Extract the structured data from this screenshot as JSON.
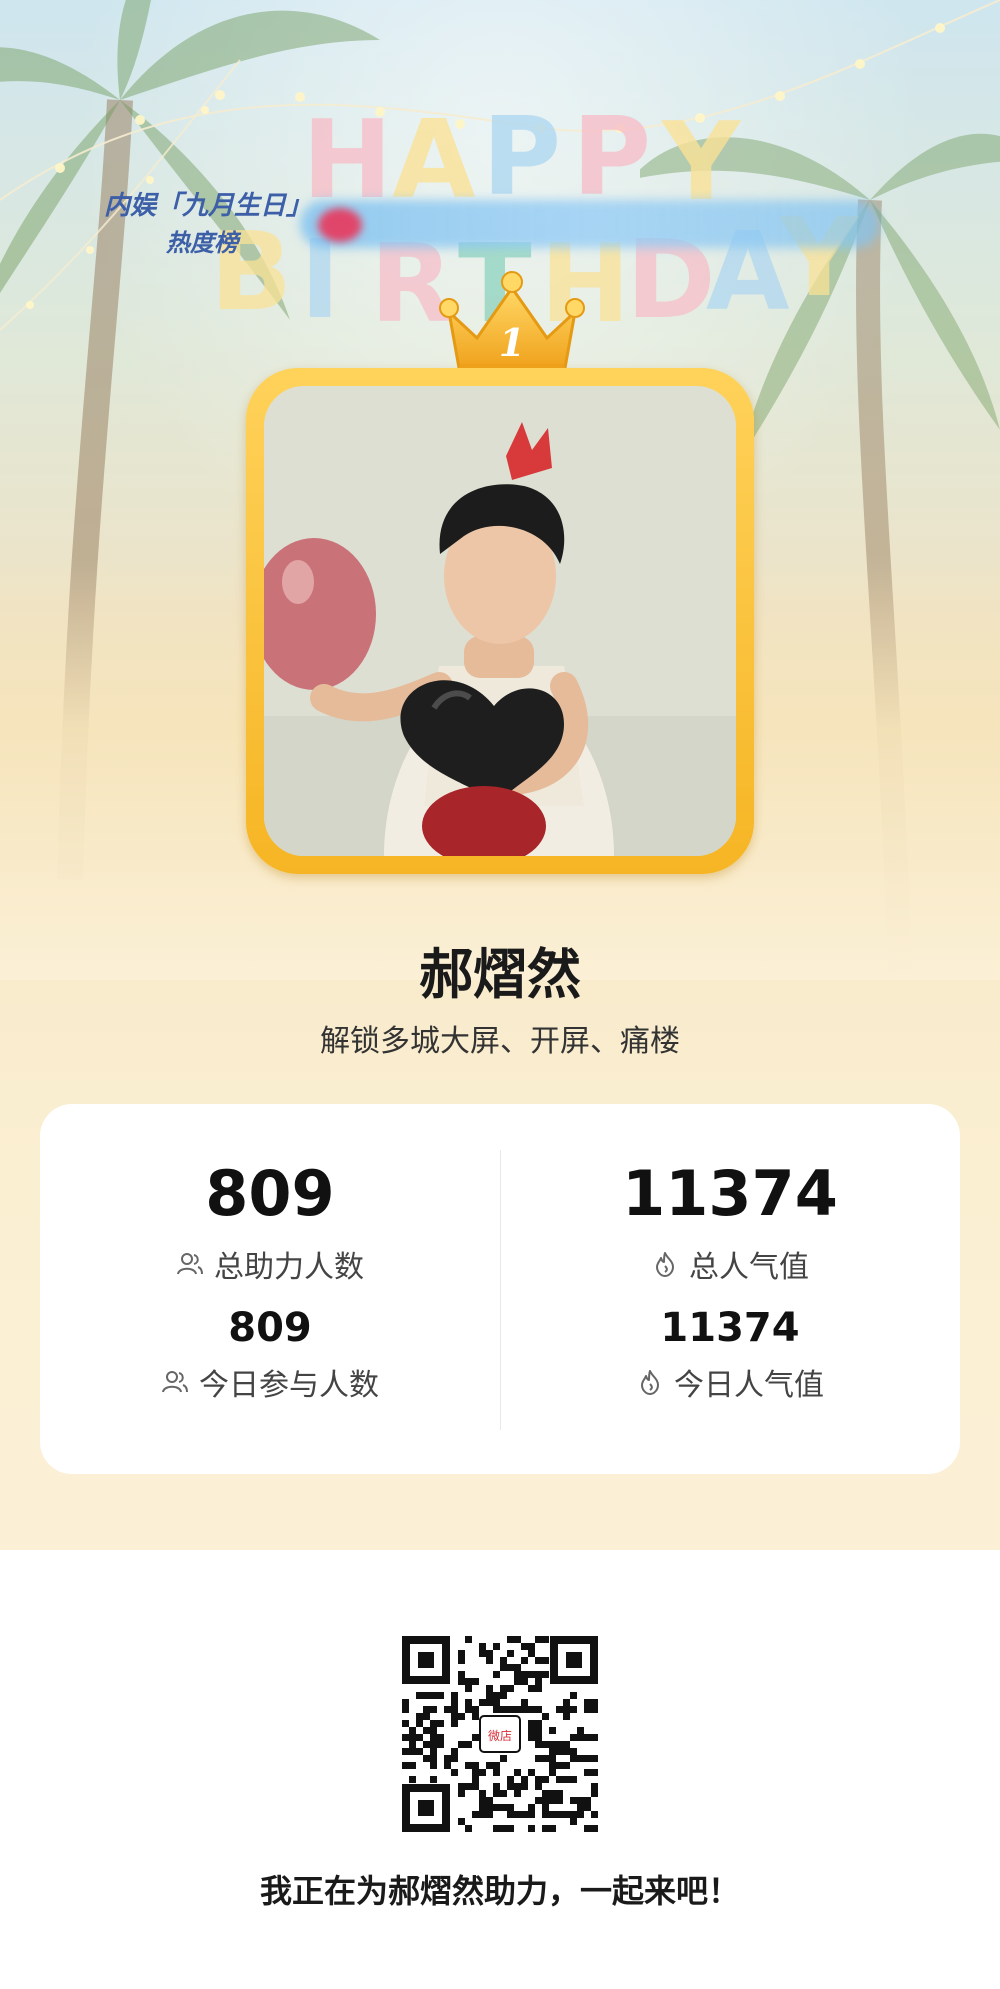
{
  "banner": {
    "greeting_letters": [
      "H",
      "A",
      "P",
      "P",
      "Y",
      "B",
      "I",
      "R",
      "T",
      "H",
      "D",
      "A",
      "Y"
    ],
    "event_logo_line1": "内娱「九月生日」",
    "event_logo_line2": "热度榜",
    "rank": "1"
  },
  "profile": {
    "name": "郝熠然",
    "subtitle": "解锁多城大屏、开屏、痛楼"
  },
  "stats": {
    "total_supporters": {
      "value": "809",
      "label": "总助力人数",
      "icon": "people-icon"
    },
    "total_popularity": {
      "value": "11374",
      "label": "总人气值",
      "icon": "flame-icon"
    },
    "today_participants": {
      "value": "809",
      "label": "今日参与人数",
      "icon": "people-icon"
    },
    "today_popularity": {
      "value": "11374",
      "label": "今日人气值",
      "icon": "flame-icon"
    }
  },
  "qr": {
    "center_text": "微店"
  },
  "cta": "我正在为郝熠然助力，一起来吧！",
  "colors": {
    "frame_gold": "#f6b524",
    "logo_blue": "#3c5fa8",
    "card_bg": "#ffffff",
    "page_bg": "#fbf0d6"
  }
}
